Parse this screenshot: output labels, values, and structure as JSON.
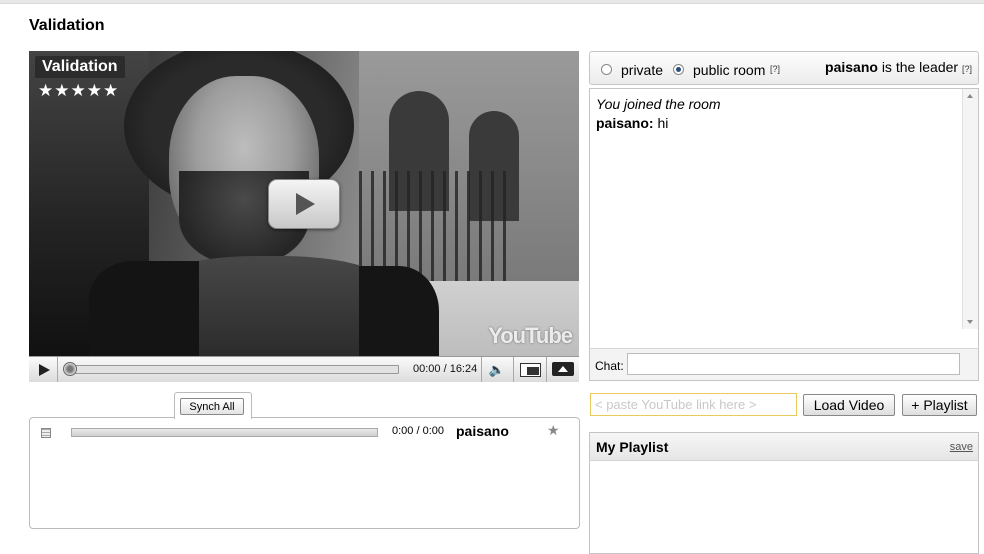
{
  "page": {
    "title": "Validation"
  },
  "video": {
    "overlay_title": "Validation",
    "stars": "★★★★★",
    "brand": "YouTube",
    "time": "00:00 / 16:24",
    "volume_icon": "speaker-icon"
  },
  "sync": {
    "button_label": "Synch All",
    "time": "0:00 / 0:00",
    "user": "paisano",
    "star": "★"
  },
  "room": {
    "private_label": "private",
    "public_label": "public room",
    "selected": "public room",
    "help_mark": "[?]",
    "leader_name": "paisano",
    "leader_suffix": "is the leader",
    "leader_help": "[?]"
  },
  "chat": {
    "system_message": "You joined the room",
    "messages": [
      {
        "user": "paisano:",
        "text": "hi"
      }
    ],
    "input_label": "Chat:"
  },
  "link": {
    "placeholder": "< paste YouTube link here >",
    "load_label": "Load Video",
    "playlist_label": "+ Playlist"
  },
  "playlist": {
    "title": "My Playlist",
    "save_label": "save"
  }
}
